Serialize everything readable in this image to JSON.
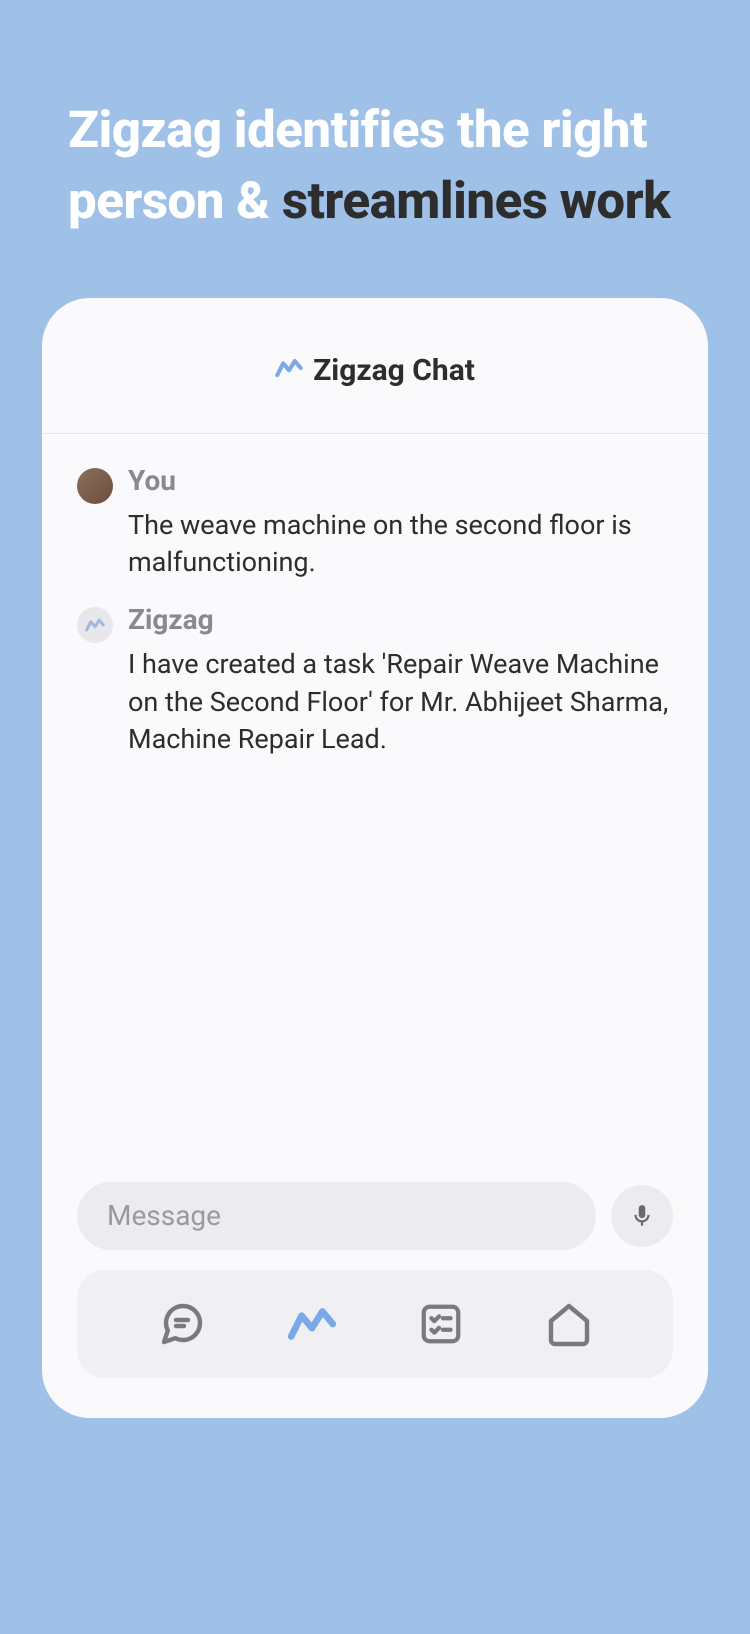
{
  "hero": {
    "line1": "Zigzag identifies the right person & ",
    "line2": "streamlines work"
  },
  "chat": {
    "title": "Zigzag Chat",
    "messages": [
      {
        "sender": "You",
        "text": "The weave machine on the second floor is malfunctioning."
      },
      {
        "sender": "Zigzag",
        "text": "I have created a task 'Repair Weave Machine on the Second Floor' for Mr. Abhijeet Sharma, Machine Repair Lead."
      }
    ],
    "input_placeholder": "Message"
  },
  "nav": {
    "items": [
      "chat",
      "zigzag",
      "tasks",
      "home"
    ]
  }
}
